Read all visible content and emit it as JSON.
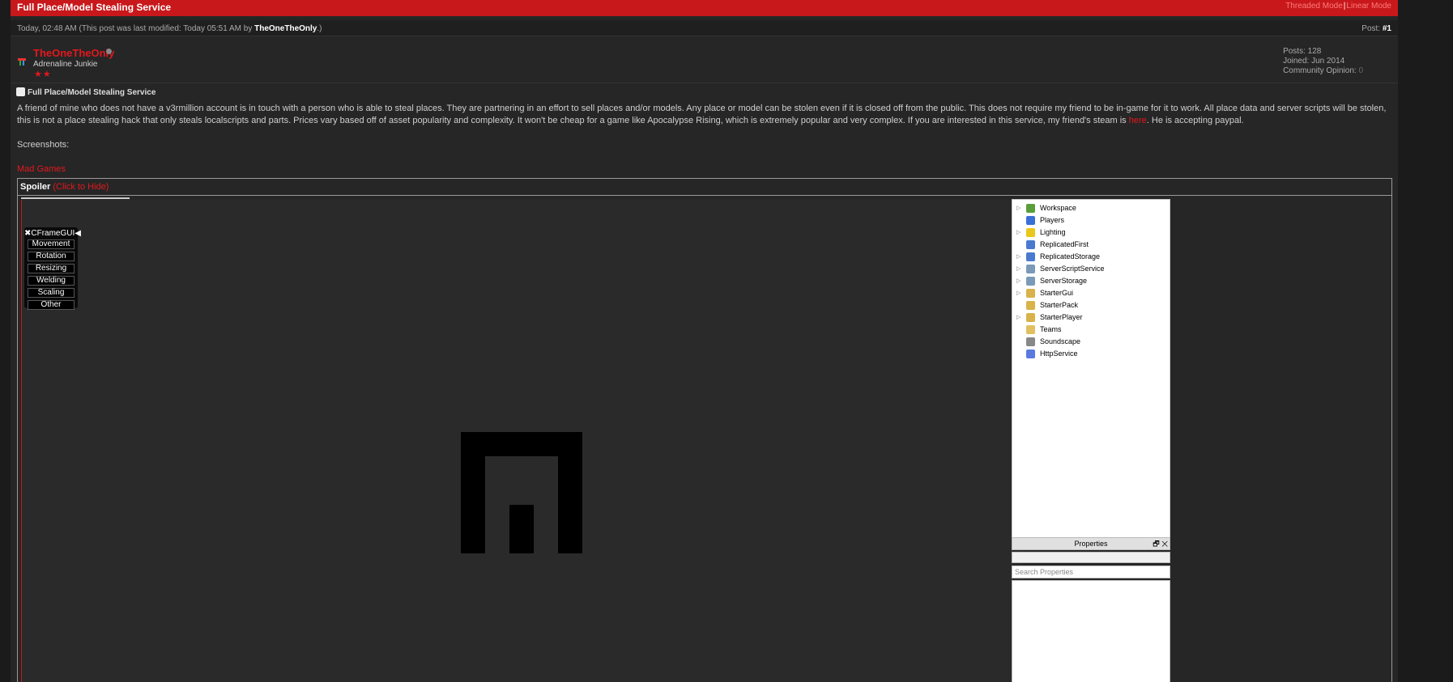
{
  "header": {
    "title": "Full Place/Model Stealing Service",
    "mode_threaded": "Threaded Mode",
    "mode_separator": "|",
    "mode_linear": "Linear Mode"
  },
  "meta": {
    "posted": "Today, 02:48 AM (This post was last modified: Today 05:51 AM by ",
    "modifier": "TheOneTheOnly",
    "posted_end": ".)",
    "post_label": "Post: ",
    "post_number": "#1"
  },
  "user": {
    "name": "TheOneTheOnly",
    "title": "Adrenaline Junkie",
    "stars": "★★",
    "posts": "Posts: 128",
    "joined": "Joined: Jun 2014",
    "opinion_label": "Community Opinion: ",
    "opinion_value": "0"
  },
  "post": {
    "title": "Full Place/Model Stealing Service",
    "body_part1": "A friend of mine who does not have a v3rmillion account is in touch with a person who is able to steal places. They are partnering in an effort to sell places and/or models. Any place or model can be stolen even if it is closed off from the public. This does not require my friend to be in-game for it to work. All place data and server scripts will be stolen, this is not a place stealing hack that only steals localscripts and parts. Prices vary based off of asset popularity and complexity. It won't be cheap for a game like Apocalypse Rising, which is extremely popular and very complex. If you are interested in this service, my friend's steam is ",
    "link_text": "here",
    "body_part2": ". He is accepting paypal.",
    "screenshots_label": "Screenshots:",
    "mad_games": "Mad Games"
  },
  "spoiler": {
    "label": "Spoiler",
    "toggle": "(Click to Hide)"
  },
  "cframe_gui": {
    "title": "✖CFrameGUI◀",
    "buttons": [
      "Movement",
      "Rotation",
      "Resizing",
      "Welding",
      "Scaling",
      "Other"
    ]
  },
  "explorer": {
    "items": [
      {
        "name": "Workspace",
        "arrow": "▷",
        "icon": "globe-icon",
        "color": "#5a9e3a"
      },
      {
        "name": "Players",
        "arrow": "",
        "icon": "players-icon",
        "color": "#3a6fd6"
      },
      {
        "name": "Lighting",
        "arrow": "▷",
        "icon": "bulb-icon",
        "color": "#e8c81a"
      },
      {
        "name": "ReplicatedFirst",
        "arrow": "",
        "icon": "replicated-first-icon",
        "color": "#4a7ad0"
      },
      {
        "name": "ReplicatedStorage",
        "arrow": "▷",
        "icon": "replicated-storage-icon",
        "color": "#4a7ad0"
      },
      {
        "name": "ServerScriptService",
        "arrow": "▷",
        "icon": "server-script-icon",
        "color": "#7a9ab8"
      },
      {
        "name": "ServerStorage",
        "arrow": "▷",
        "icon": "server-storage-icon",
        "color": "#7a9ab8"
      },
      {
        "name": "StarterGui",
        "arrow": "▷",
        "icon": "starter-gui-icon",
        "color": "#d8b24a"
      },
      {
        "name": "StarterPack",
        "arrow": "",
        "icon": "starter-pack-icon",
        "color": "#d8b24a"
      },
      {
        "name": "StarterPlayer",
        "arrow": "▷",
        "icon": "starter-player-icon",
        "color": "#d8b24a"
      },
      {
        "name": "Teams",
        "arrow": "",
        "icon": "teams-icon",
        "color": "#e0c060"
      },
      {
        "name": "Soundscape",
        "arrow": "",
        "icon": "speaker-icon",
        "color": "#888888"
      },
      {
        "name": "HttpService",
        "arrow": "",
        "icon": "http-icon",
        "color": "#5a7ae0"
      }
    ]
  },
  "properties": {
    "title": "Properties",
    "controls": "🗗 ✕",
    "search_placeholder": "Search Properties"
  }
}
